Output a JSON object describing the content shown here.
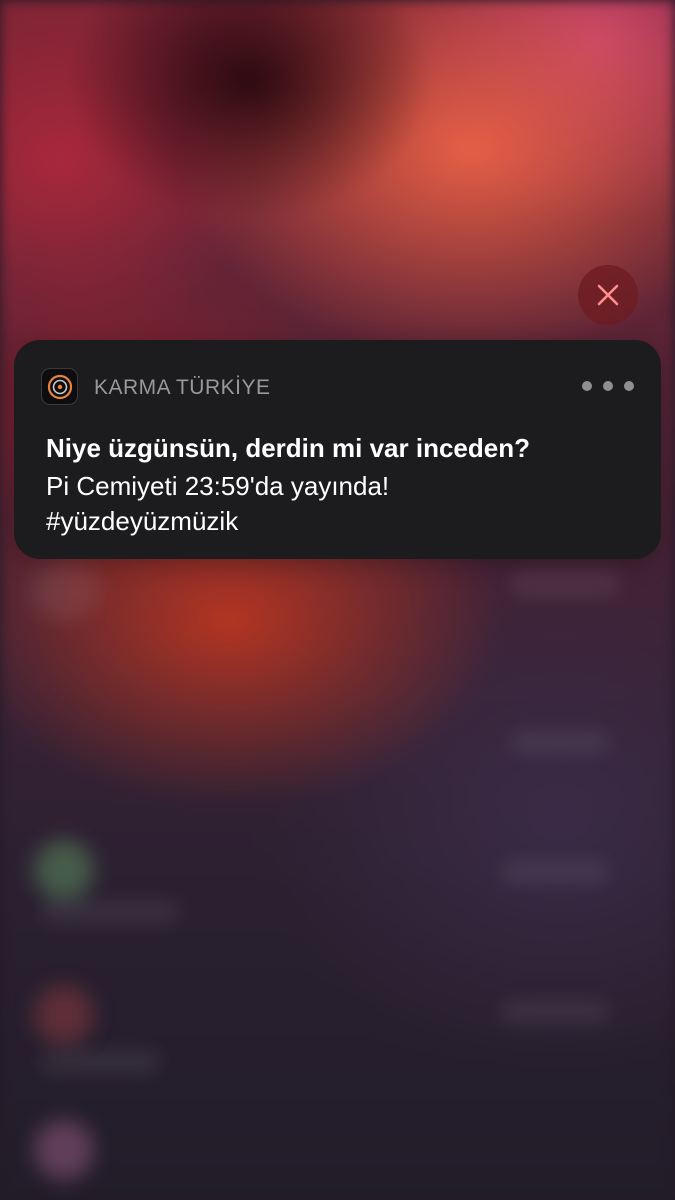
{
  "notification": {
    "app_name": "KARMA TÜRKİYE",
    "title": "Niye üzgünsün, derdin mi var inceden?",
    "body_lines": [
      "Pi Cemiyeti 23:59'da yayında!",
      "#yüzdeyüzmüzik"
    ]
  },
  "icons": {
    "app_icon": "vinyl-record-icon",
    "close": "close-icon",
    "more": "more-options-icon"
  },
  "colors": {
    "card_background": "#1c1c1e",
    "app_name": "#98989d",
    "close_button": "#6e1c22",
    "app_icon_accent": "#e8843c"
  }
}
